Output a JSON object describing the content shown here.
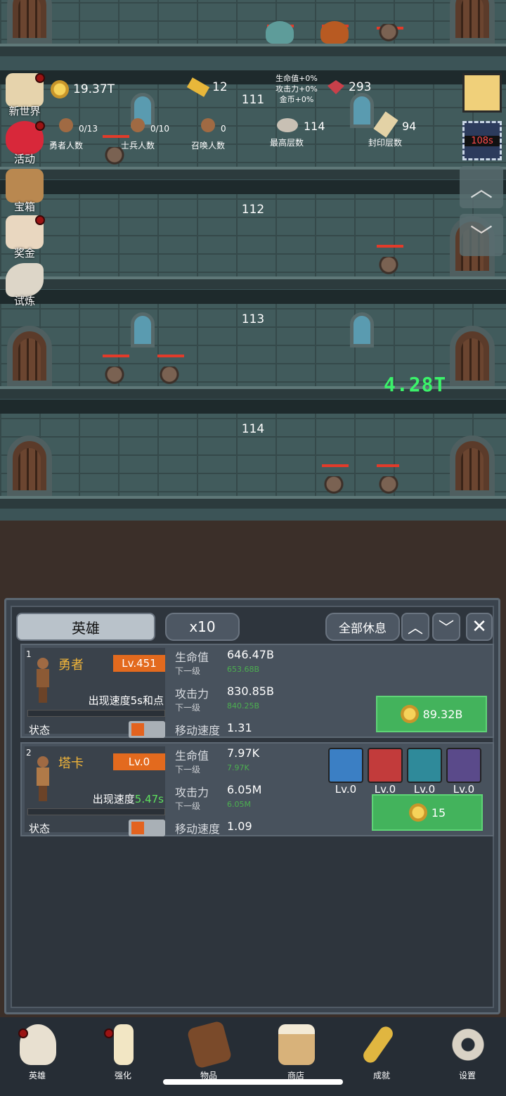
{
  "hud": {
    "gold": "19.37T",
    "gold_bars": "12",
    "buffs": [
      "生命值+0%",
      "攻击力+0%",
      "金币+0%"
    ],
    "gems": "293",
    "braves": {
      "value": "0/13",
      "label": "勇者人数"
    },
    "soldiers": {
      "value": "0/10",
      "label": "士兵人数"
    },
    "summons": {
      "value": "0",
      "label": "召唤人数"
    },
    "highest": {
      "value": "114",
      "label": "最高层数"
    },
    "sealed": {
      "value": "94",
      "label": "封印层数"
    },
    "timer": "108s"
  },
  "floors": [
    "111",
    "112",
    "113",
    "114"
  ],
  "damage_text": "4.28T",
  "side_menu": [
    "新世界",
    "活动",
    "宝箱",
    "奖金",
    "试炼"
  ],
  "panel": {
    "tab": "英雄",
    "multiplier": "x10",
    "rest_all": "全部休息"
  },
  "heroes": [
    {
      "index": "1",
      "name": "勇者",
      "level": "Lv.451",
      "speed": "出现速度5s和点",
      "state": "状态",
      "hp_label": "生命值",
      "hp": "646.47B",
      "hp_next_label": "下一级",
      "hp_next": "653.68B",
      "atk_label": "攻击力",
      "atk": "830.85B",
      "atk_next_label": "下一级",
      "atk_next": "840.25B",
      "move_label": "移动速度",
      "move": "1.31",
      "cost": "89.32B"
    },
    {
      "index": "2",
      "name": "塔卡",
      "level": "Lv.0",
      "speed_prefix": "出现速度",
      "speed_value": "5.47s",
      "state": "状态",
      "hp_label": "生命值",
      "hp": "7.97K",
      "hp_next_label": "下一级",
      "hp_next": "7.97K",
      "atk_label": "攻击力",
      "atk": "6.05M",
      "atk_next_label": "下一级",
      "atk_next": "6.05M",
      "move_label": "移动速度",
      "move": "1.09",
      "cost": "15",
      "skills": [
        "Lv.0",
        "Lv.0",
        "Lv.0",
        "Lv.0"
      ]
    }
  ],
  "nav": [
    "英雄",
    "强化",
    "物品",
    "商店",
    "成就",
    "设置"
  ]
}
